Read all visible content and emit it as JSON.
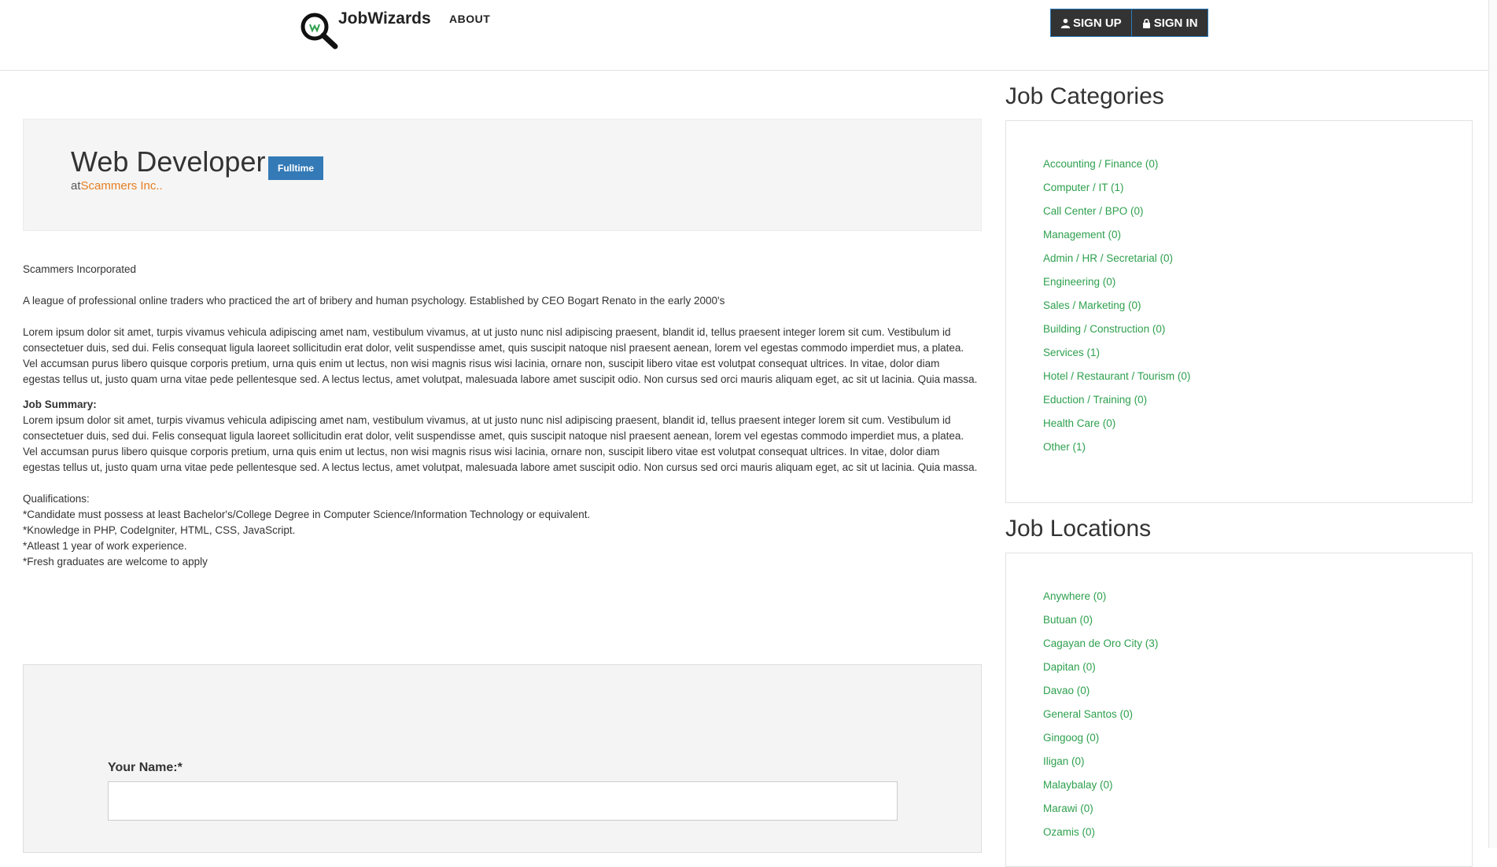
{
  "header": {
    "brand": "JobWizards",
    "nav": {
      "about": "ABOUT"
    },
    "auth": {
      "sign_up": "SIGN UP",
      "sign_in": "SIGN IN"
    }
  },
  "job": {
    "title": "Web Developer",
    "type_badge": "Fulltime",
    "at_prefix": "at",
    "company": "Scammers Inc.."
  },
  "content": {
    "company_name": "Scammers Incorporated",
    "company_description": "A league of professional online traders who practiced the art of bribery and human psychology. Established by CEO Bogart Renato in the early 2000's",
    "description": "Lorem ipsum dolor sit amet, turpis vivamus vehicula adipiscing amet nam, vestibulum vivamus, at ut justo nunc nisl adipiscing praesent, blandit id, tellus praesent integer lorem sit cum. Vestibulum id consectetuer duis, sed dui. Felis consequat ligula laoreet sollicitudin erat dolor, velit suspendisse amet, quis suscipit natoque nisl praesent aenean, lorem vel egestas commodo imperdiet mus, a platea. Vel accumsan purus libero quisque corporis pretium, urna quis enim ut lectus, non wisi magnis risus wisi lacinia, ornare non, suscipit libero vitae est volutpat consequat ultrices. In vitae, dolor diam egestas tellus ut, justo quam urna vitae pede pellentesque sed. A lectus lectus, amet volutpat, malesuada labore amet suscipit odio. Non cursus sed orci mauris aliquam eget, ac sit ut lacinia. Quia massa.",
    "summary_label": "Job Summary:",
    "summary": "Lorem ipsum dolor sit amet, turpis vivamus vehicula adipiscing amet nam, vestibulum vivamus, at ut justo nunc nisl adipiscing praesent, blandit id, tellus praesent integer lorem sit cum. Vestibulum id consectetuer duis, sed dui. Felis consequat ligula laoreet sollicitudin erat dolor, velit suspendisse amet, quis suscipit natoque nisl praesent aenean, lorem vel egestas commodo imperdiet mus, a platea. Vel accumsan purus libero quisque corporis pretium, urna quis enim ut lectus, non wisi magnis risus wisi lacinia, ornare non, suscipit libero vitae est volutpat consequat ultrices. In vitae, dolor diam egestas tellus ut, justo quam urna vitae pede pellentesque sed. A lectus lectus, amet volutpat, malesuada labore amet suscipit odio. Non cursus sed orci mauris aliquam eget, ac sit ut lacinia. Quia massa.",
    "qualifications_label": "Qualifications:",
    "qualifications": [
      "*Candidate must possess at least Bachelor's/College Degree in Computer Science/Information Technology or equivalent.",
      "*Knowledge in PHP, CodeIgniter, HTML, CSS, JavaScript.",
      "*Atleast 1 year of work experience.",
      "*Fresh graduates are welcome to apply"
    ]
  },
  "form": {
    "name_label": "Your Name:*",
    "name_value": ""
  },
  "sidebar": {
    "categories_title": "Job Categories",
    "categories": [
      "Accounting / Finance (0)",
      "Computer / IT (1)",
      "Call Center / BPO (0)",
      "Management (0)",
      "Admin / HR / Secretarial (0)",
      "Engineering (0)",
      "Sales / Marketing (0)",
      "Building / Construction (0)",
      "Services (1)",
      "Hotel / Restaurant / Tourism (0)",
      "Eduction / Training (0)",
      "Health Care (0)",
      "Other (1)"
    ],
    "locations_title": "Job Locations",
    "locations": [
      "Anywhere (0)",
      "Butuan (0)",
      "Cagayan de Oro City (3)",
      "Dapitan (0)",
      "Davao (0)",
      "General Santos (0)",
      "Gingoog (0)",
      "Iligan (0)",
      "Malaybalay (0)",
      "Marawi (0)",
      "Ozamis (0)"
    ]
  },
  "colors": {
    "link_green": "#2ea04e",
    "company_orange": "#e67e22",
    "badge_blue": "#337ab7",
    "auth_dark": "#333333"
  }
}
